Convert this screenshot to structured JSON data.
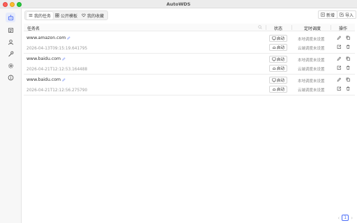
{
  "window": {
    "title": "AutoWDS"
  },
  "sidebar": {
    "items": [
      {
        "name": "sidebar-item-robot",
        "icon": "robot-icon",
        "active": true
      },
      {
        "name": "sidebar-item-list",
        "icon": "list-icon",
        "active": false
      },
      {
        "name": "sidebar-item-user",
        "icon": "user-icon",
        "active": false
      },
      {
        "name": "sidebar-item-tools",
        "icon": "wrench-icon",
        "active": false
      },
      {
        "name": "sidebar-item-settings",
        "icon": "gear-icon",
        "active": false
      },
      {
        "name": "sidebar-item-info",
        "icon": "info-icon",
        "active": false
      }
    ]
  },
  "toolbar": {
    "tabs": [
      {
        "label": "我的任务",
        "icon": "list-icon",
        "active": true
      },
      {
        "label": "公开模板",
        "icon": "grid-icon",
        "active": false
      },
      {
        "label": "我的收藏",
        "icon": "heart-icon",
        "active": false
      }
    ],
    "new_label": "新增",
    "import_label": "导入"
  },
  "table": {
    "headers": {
      "name": "任务名",
      "status": "状态",
      "schedule": "定时调度",
      "actions": "操作"
    },
    "rows": [
      {
        "url": "www.amazon.com",
        "timestamp": "2026-04-13T09:15:19.641795",
        "local_label": "启动",
        "cloud_label": "启动",
        "local_schedule": "本地调度未设置",
        "cloud_schedule": "云端调度未设置"
      },
      {
        "url": "www.baidu.com",
        "timestamp": "2026-04-21T12:12:53.164488",
        "local_label": "启动",
        "cloud_label": "启动",
        "local_schedule": "本地调度未设置",
        "cloud_schedule": "云端调度未设置"
      },
      {
        "url": "www.baidu.com",
        "timestamp": "2026-04-21T12:12:56.275790",
        "local_label": "启动",
        "cloud_label": "启动",
        "local_schedule": "本地调度未设置",
        "cloud_schedule": "云端调度未设置"
      }
    ]
  },
  "pagination": {
    "current_page": "1"
  },
  "colors": {
    "accent": "#4a6cf7",
    "active_bg": "#e6ebfb"
  }
}
